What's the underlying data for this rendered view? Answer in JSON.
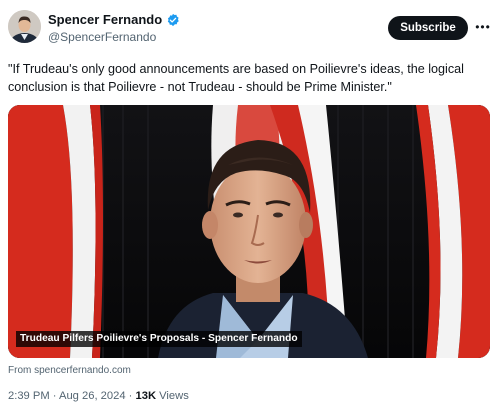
{
  "author": {
    "display_name": "Spencer Fernando",
    "handle": "@SpencerFernando",
    "verified": true
  },
  "actions": {
    "subscribe_label": "Subscribe",
    "more_label": "•••"
  },
  "tweet": {
    "text": "\"If Trudeau's only good announcements are based on Poilievre's ideas, the logical conclusion is that Poilievre - not Trudeau - should be Prime Minister.\""
  },
  "media": {
    "caption": "Trudeau Pilfers Poilievre's Proposals - Spencer Fernando",
    "source": "From spencerfernando.com"
  },
  "meta": {
    "time": "2:39 PM",
    "separator_1": " · ",
    "date": "Aug 26, 2024",
    "separator_2": " · ",
    "views_count": "13K",
    "views_label": " Views"
  },
  "colors": {
    "verified_badge": "#1d9bf0",
    "subscribe_bg": "#0f1419",
    "secondary_text": "#536471",
    "flag_red": "#d52b1e"
  },
  "icons": {
    "verified": "verified-badge-icon",
    "more": "more-options-icon"
  }
}
